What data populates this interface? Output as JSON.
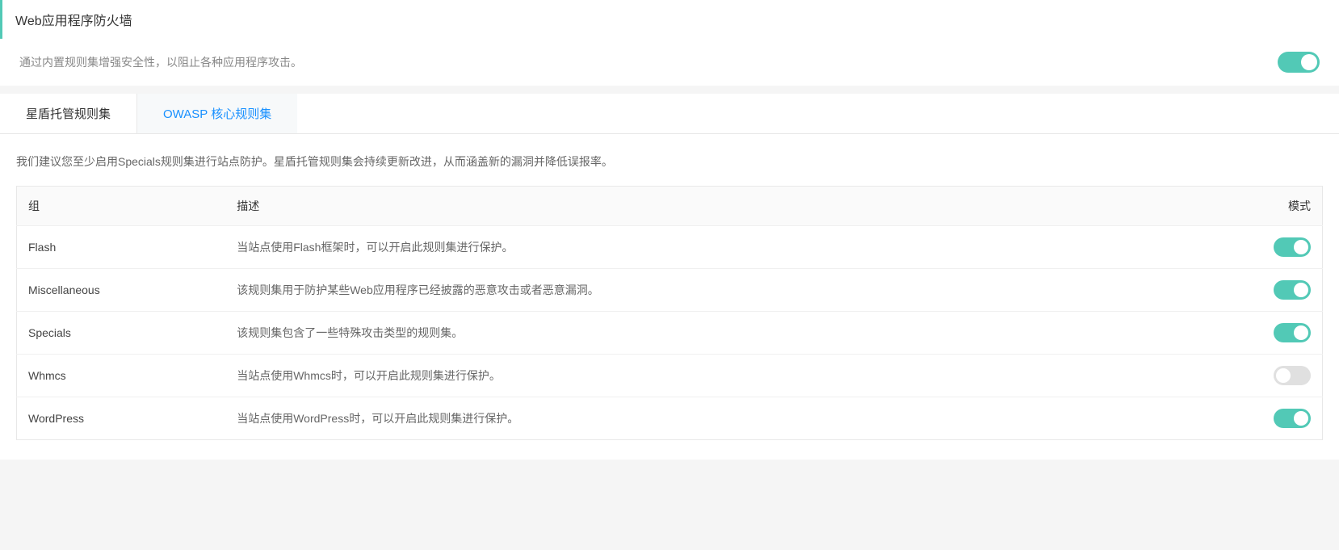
{
  "header": {
    "title": "Web应用程序防火墙",
    "description": "通过内置规则集增强安全性，以阻止各种应用程序攻击。",
    "master_toggle": true
  },
  "tabs": [
    {
      "label": "星盾托管规则集",
      "active": true
    },
    {
      "label": "OWASP 核心规则集",
      "active": false
    }
  ],
  "content": {
    "recommendation": "我们建议您至少启用Specials规则集进行站点防护。星盾托管规则集会持续更新改进，从而涵盖新的漏洞并降低误报率。",
    "table": {
      "headers": {
        "group": "组",
        "description": "描述",
        "mode": "模式"
      },
      "rows": [
        {
          "group": "Flash",
          "description": "当站点使用Flash框架时，可以开启此规则集进行保护。",
          "enabled": true
        },
        {
          "group": "Miscellaneous",
          "description": "该规则集用于防护某些Web应用程序已经披露的恶意攻击或者恶意漏洞。",
          "enabled": true
        },
        {
          "group": "Specials",
          "description": "该规则集包含了一些特殊攻击类型的规则集。",
          "enabled": true
        },
        {
          "group": "Whmcs",
          "description": "当站点使用Whmcs时，可以开启此规则集进行保护。",
          "enabled": false
        },
        {
          "group": "WordPress",
          "description": "当站点使用WordPress时，可以开启此规则集进行保护。",
          "enabled": true
        }
      ]
    }
  }
}
